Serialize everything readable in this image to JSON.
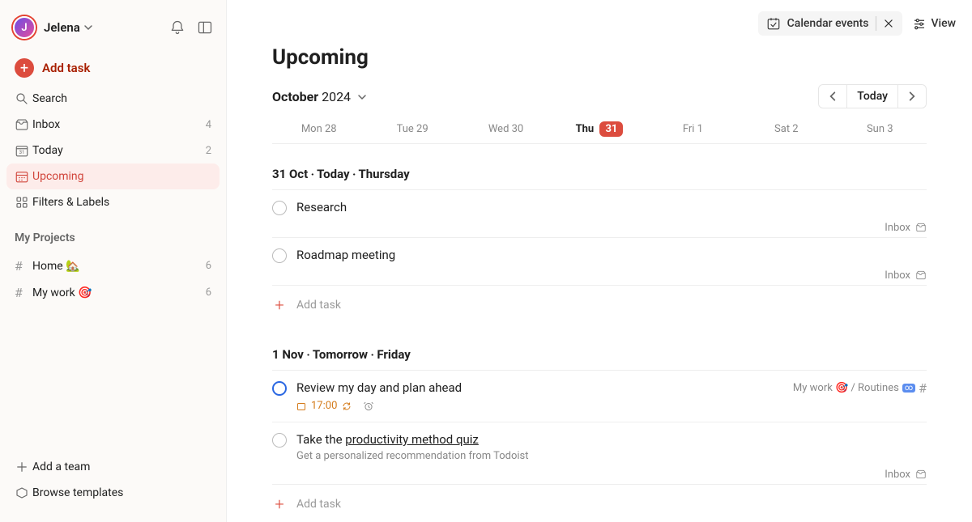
{
  "user": {
    "initial": "J",
    "name": "Jelena"
  },
  "sidebar": {
    "add_task": "Add task",
    "items": [
      {
        "icon": "search",
        "label": "Search"
      },
      {
        "icon": "inbox",
        "label": "Inbox",
        "count": "4"
      },
      {
        "icon": "calendar-day",
        "label": "Today",
        "count": "2"
      },
      {
        "icon": "calendar-grid",
        "label": "Upcoming",
        "active": true
      },
      {
        "icon": "grid",
        "label": "Filters & Labels"
      }
    ],
    "projects_title": "My Projects",
    "projects": [
      {
        "label": "Home 🏡",
        "count": "6"
      },
      {
        "label": "My work 🎯",
        "count": "6"
      }
    ],
    "add_team": "Add a team",
    "browse_templates": "Browse templates"
  },
  "topbar": {
    "calendar_events": "Calendar events",
    "view": "View"
  },
  "page": {
    "title": "Upcoming",
    "month": "October",
    "year": "2024",
    "today_btn": "Today",
    "weekdays": [
      {
        "label": "Mon 28"
      },
      {
        "label": "Tue 29"
      },
      {
        "label": "Wed 30"
      },
      {
        "label": "Thu",
        "day": "31",
        "today": true
      },
      {
        "label": "Fri 1"
      },
      {
        "label": "Sat 2"
      },
      {
        "label": "Sun 3"
      }
    ],
    "groups": [
      {
        "header": "31 Oct ‧ Today ‧ Thursday",
        "tasks": [
          {
            "title": "Research",
            "meta_project": "Inbox",
            "meta_icon": "inbox"
          },
          {
            "title": "Roadmap meeting",
            "meta_project": "Inbox",
            "meta_icon": "inbox"
          }
        ],
        "add_task": "Add task"
      },
      {
        "header": "1 Nov ‧ Tomorrow ‧ Friday",
        "tasks": [
          {
            "title": "Review my day and plan ahead",
            "check": "blue",
            "time": "17:00",
            "recurring": true,
            "alarm": true,
            "right_meta": "My work 🎯 / Routines",
            "right_meta_badge": "☁",
            "right_meta_hash": "#"
          },
          {
            "title_pre": "Take the ",
            "title_link": "productivity method quiz",
            "subtitle": "Get a personalized recommendation from Todoist",
            "meta_project": "Inbox",
            "meta_icon": "inbox"
          }
        ],
        "add_task": "Add task"
      }
    ]
  }
}
